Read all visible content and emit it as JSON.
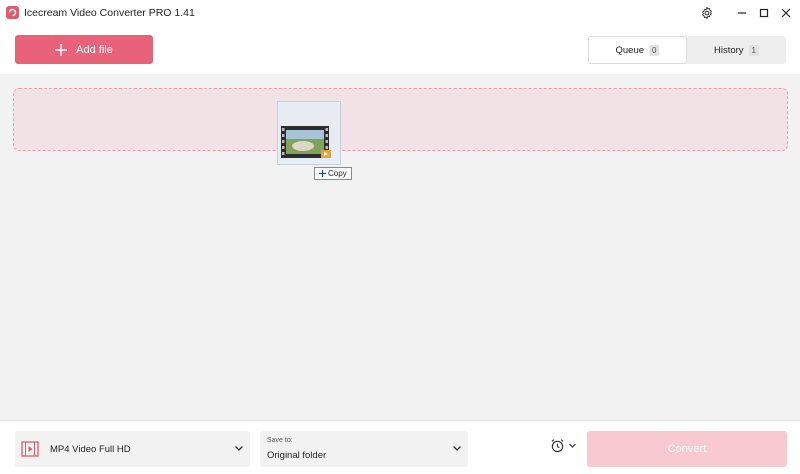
{
  "window": {
    "title": "Icecream Video Converter PRO 1.41",
    "controls": [
      "minimize-icon",
      "maximize-icon",
      "close-icon"
    ],
    "settings_icon": "gear-icon"
  },
  "toolbar": {
    "add_file_label": "Add file",
    "add_file_icon": "plus-icon",
    "tabs": [
      {
        "label": "Queue",
        "count": "0",
        "active": true
      },
      {
        "label": "History",
        "count": "1",
        "active": false
      }
    ]
  },
  "drag_overlay": {
    "copy_label": "Copy",
    "thumbnail_icon": "video-file-icon"
  },
  "bottom": {
    "format": {
      "icon": "video-film-icon",
      "value": "MP4 Video Full HD"
    },
    "save_to": {
      "caption": "Save to:",
      "value": "Original folder"
    },
    "timer_icon": "alarm-clock-icon",
    "convert_label": "Convert"
  },
  "colors": {
    "accent": "#e8637a",
    "dropzone_bg": "#f1e3e5",
    "dropzone_border": "#e8a2ad",
    "convert_disabled": "#f9c9d0"
  }
}
